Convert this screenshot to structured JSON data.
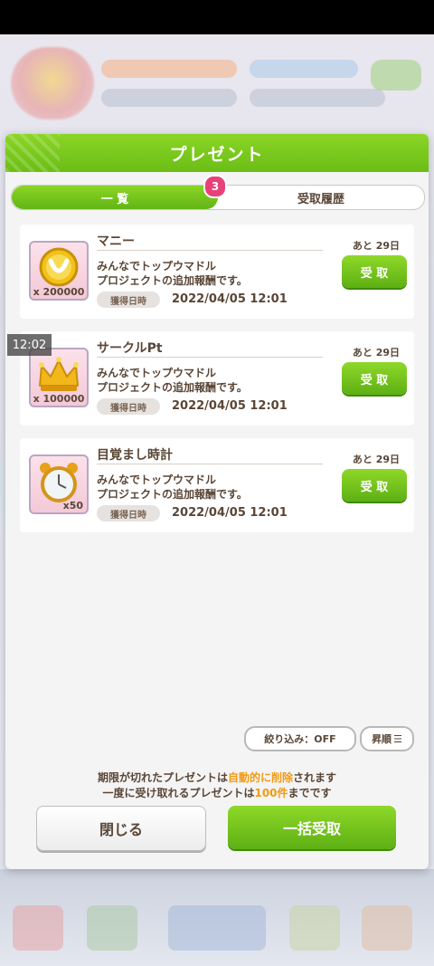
{
  "dialog": {
    "title": "プレゼント",
    "tabs": [
      {
        "label": "一 覧",
        "active": true,
        "badge": "3"
      },
      {
        "label": "受取履歴",
        "active": false
      }
    ]
  },
  "presents": [
    {
      "name": "マニー",
      "icon": "horseshoe-coin-icon",
      "qty": "x 200000",
      "description": "みんなでトップウマドル\nプロジェクトの追加報酬です。",
      "obtained_label": "獲得日時",
      "obtained_at": "2022/04/05 12:01",
      "remaining": "あと 29日",
      "receive_label": "受 取"
    },
    {
      "name": "サークルPt",
      "icon": "crown-icon",
      "qty": "x 100000",
      "description": "みんなでトップウマドル\nプロジェクトの追加報酬です。",
      "obtained_label": "獲得日時",
      "obtained_at": "2022/04/05 12:01",
      "remaining": "あと 29日",
      "receive_label": "受 取"
    },
    {
      "name": "目覚まし時計",
      "icon": "alarm-clock-icon",
      "qty": "x50",
      "description": "みんなでトップウマドル\nプロジェクトの追加報酬です。",
      "obtained_label": "獲得日時",
      "obtained_at": "2022/04/05 12:01",
      "remaining": "あと 29日",
      "receive_label": "受 取"
    }
  ],
  "filter": {
    "filter_label": "絞り込み：OFF",
    "sort_label": "昇順"
  },
  "info": {
    "line1_a": "期限が切れたプレゼントは",
    "line1_b": "自動的に削除",
    "line1_c": "されます",
    "line2_a": "一度に受け取れるプレゼントは",
    "line2_b": "100件",
    "line2_c": "までです"
  },
  "buttons": {
    "close": "閉じる",
    "receive_all": "一括受取"
  },
  "overlay_time": "12:02",
  "colors": {
    "accent_green": "#6bbd16",
    "badge_pink": "#e8417a",
    "text_brown": "#5a4636",
    "highlight_orange": "#f29a12"
  }
}
